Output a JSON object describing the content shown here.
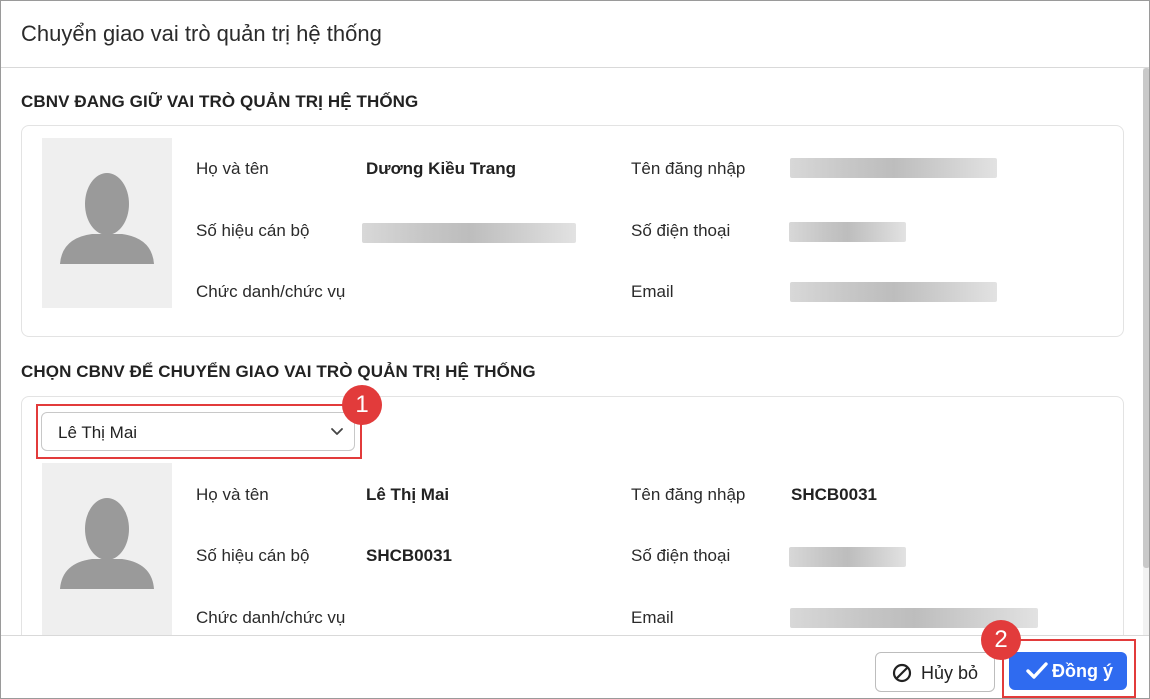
{
  "dialog": {
    "title": "Chuyển giao vai trò quản trị hệ thống"
  },
  "current_admin": {
    "section_title": "CBNV ĐANG GIỮ VAI TRÒ QUẢN TRỊ HỆ THỐNG",
    "labels": {
      "full_name": "Họ và tên",
      "staff_id": "Số hiệu cán bộ",
      "position": "Chức danh/chức vụ",
      "username": "Tên đăng nhập",
      "phone": "Số điện thoại",
      "email": "Email"
    },
    "values": {
      "full_name": "Dương Kiều Trang"
    }
  },
  "transfer_target": {
    "section_title": "CHỌN CBNV ĐỂ CHUYỂN GIAO VAI TRÒ QUẢN TRỊ HỆ THỐNG",
    "selected_employee": "Lê Thị Mai",
    "labels": {
      "full_name": "Họ và tên",
      "staff_id": "Số hiệu cán bộ",
      "position": "Chức danh/chức vụ",
      "username": "Tên đăng nhập",
      "phone": "Số điện thoại",
      "email": "Email"
    },
    "values": {
      "full_name": "Lê Thị Mai",
      "staff_id": "SHCB0031",
      "username": "SHCB0031"
    }
  },
  "footer": {
    "cancel_label": "Hủy bỏ",
    "confirm_label": "Đồng ý"
  },
  "annotations": {
    "step_1": "1",
    "step_2": "2"
  },
  "colors": {
    "primary": "#2f6bf0",
    "highlight": "#e23b3b",
    "avatar_bg": "#efefef",
    "avatar_icon": "#9a9a9a"
  },
  "icons": {
    "avatar": "user-silhouette-icon",
    "select": "chevron-down-icon",
    "cancel": "ban-icon",
    "confirm": "check-icon"
  }
}
